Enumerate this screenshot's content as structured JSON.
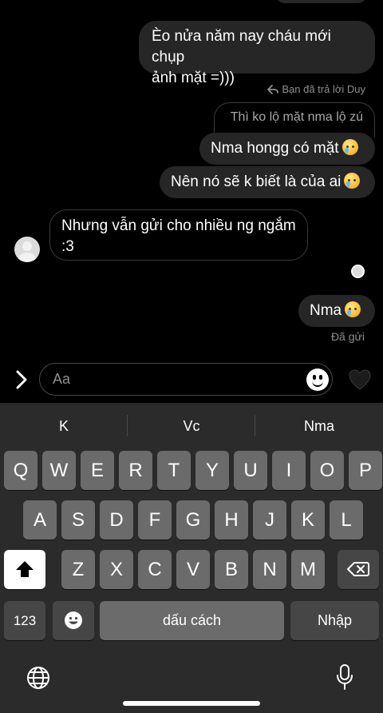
{
  "messages": {
    "m1_line1": "Èo nửa năm nay cháu mới chụp",
    "m1_line2": "ảnh mặt =)))",
    "reply_label": "Bạn đã trả lời Duy",
    "quoted": "Thì ko lộ mặt nma lộ zú",
    "m2": "Nma hongg có mặt",
    "m3": "Nên nó sẽ k biết là của ai",
    "incoming_line1": "Nhưng vẫn gửi cho nhiều ng ngắm",
    "incoming_line2": ":3",
    "m4": "Nma",
    "status": "Đã gửi"
  },
  "composer": {
    "placeholder": "Aa"
  },
  "keyboard": {
    "suggestions": [
      "K",
      "Vc",
      "Nma"
    ],
    "row1": [
      "Q",
      "W",
      "E",
      "R",
      "T",
      "Y",
      "U",
      "I",
      "O",
      "P"
    ],
    "row2": [
      "A",
      "S",
      "D",
      "F",
      "G",
      "H",
      "J",
      "K",
      "L"
    ],
    "row3": [
      "Z",
      "X",
      "C",
      "V",
      "B",
      "N",
      "M"
    ],
    "numbers_key": "123",
    "space_key": "dấu cách",
    "return_key": "Nhập"
  },
  "icons": {
    "reply": "reply-arrow-icon",
    "emoji": "crying-face-emoji",
    "expand": "chevron-right-icon",
    "sticker": "smiley-icon",
    "like": "heart-icon",
    "shift": "shift-icon",
    "delete": "backspace-icon",
    "globe": "globe-icon",
    "dictation": "microphone-icon"
  }
}
